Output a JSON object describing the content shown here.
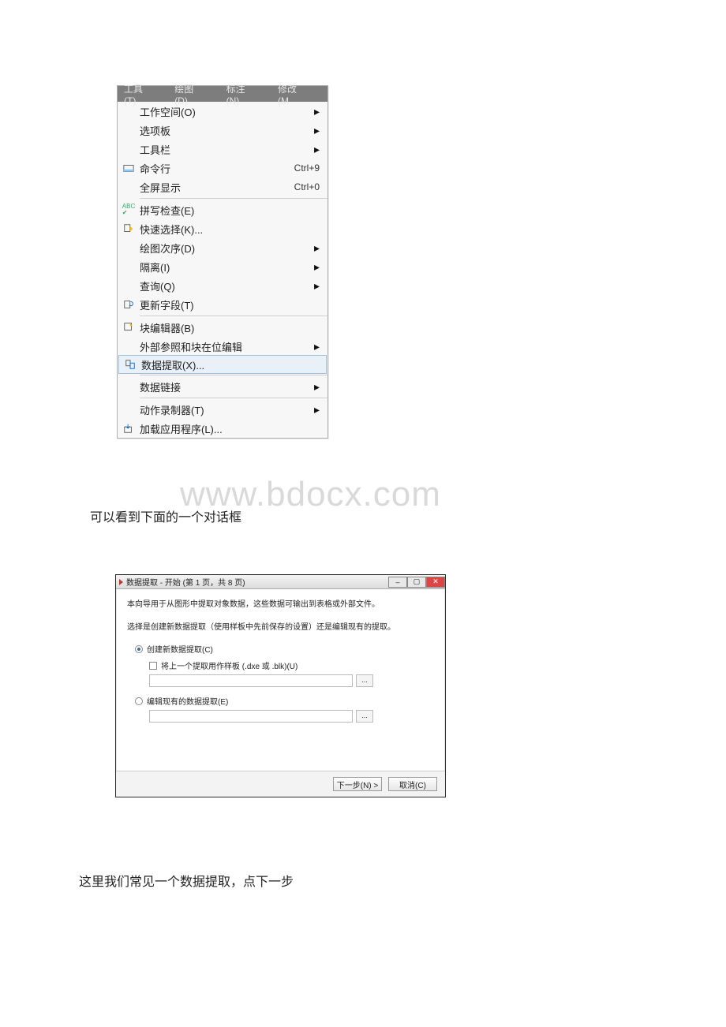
{
  "menu": {
    "header": [
      "工具(T)",
      "绘图(D)",
      "标注(N)",
      "修改(M"
    ],
    "items": [
      {
        "label": "工作空间(O)",
        "sub": true
      },
      {
        "label": "选项板",
        "sub": true
      },
      {
        "label": "工具栏",
        "sub": true
      },
      {
        "label": "命令行",
        "shortcut": "Ctrl+9",
        "icon": "cmd"
      },
      {
        "label": "全屏显示",
        "shortcut": "Ctrl+0"
      },
      {
        "sep": true
      },
      {
        "label": "拼写检查(E)",
        "icon": "abc"
      },
      {
        "label": "快速选择(K)...",
        "icon": "qsel"
      },
      {
        "label": "绘图次序(D)",
        "sub": true
      },
      {
        "label": "隔离(I)",
        "sub": true
      },
      {
        "label": "查询(Q)",
        "sub": true
      },
      {
        "label": "更新字段(T)",
        "icon": "upd"
      },
      {
        "sep": true
      },
      {
        "label": "块编辑器(B)",
        "icon": "blk"
      },
      {
        "label": "外部参照和块在位编辑",
        "sub": true
      },
      {
        "label": "数据提取(X)...",
        "icon": "ext",
        "highlight": true
      },
      {
        "sep": true
      },
      {
        "label": "数据链接",
        "sub": true
      },
      {
        "sep": true
      },
      {
        "label": "动作录制器(T)",
        "sub": true
      },
      {
        "label": "加载应用程序(L)...",
        "icon": "load"
      }
    ]
  },
  "para1": "可以看到下面的一个对话框",
  "watermark": "www.bdocx.com",
  "dialog": {
    "title": "数据提取 - 开始 (第 1 页，共 8 页)",
    "intro1": "本向导用于从图形中提取对象数据，这些数据可输出到表格或外部文件。",
    "intro2": "选择是创建新数据提取（使用样板中先前保存的设置）还是编辑现有的提取。",
    "radio_new": "创建新数据提取(C)",
    "chk_template": "将上一个提取用作样板   (.dxe 或 .blk)(U)",
    "radio_edit": "编辑现有的数据提取(E)",
    "btn_dots": "...",
    "btn_next": "下一步(N) >",
    "btn_cancel": "取消(C)"
  },
  "para2": "这里我们常见一个数据提取，点下一步"
}
